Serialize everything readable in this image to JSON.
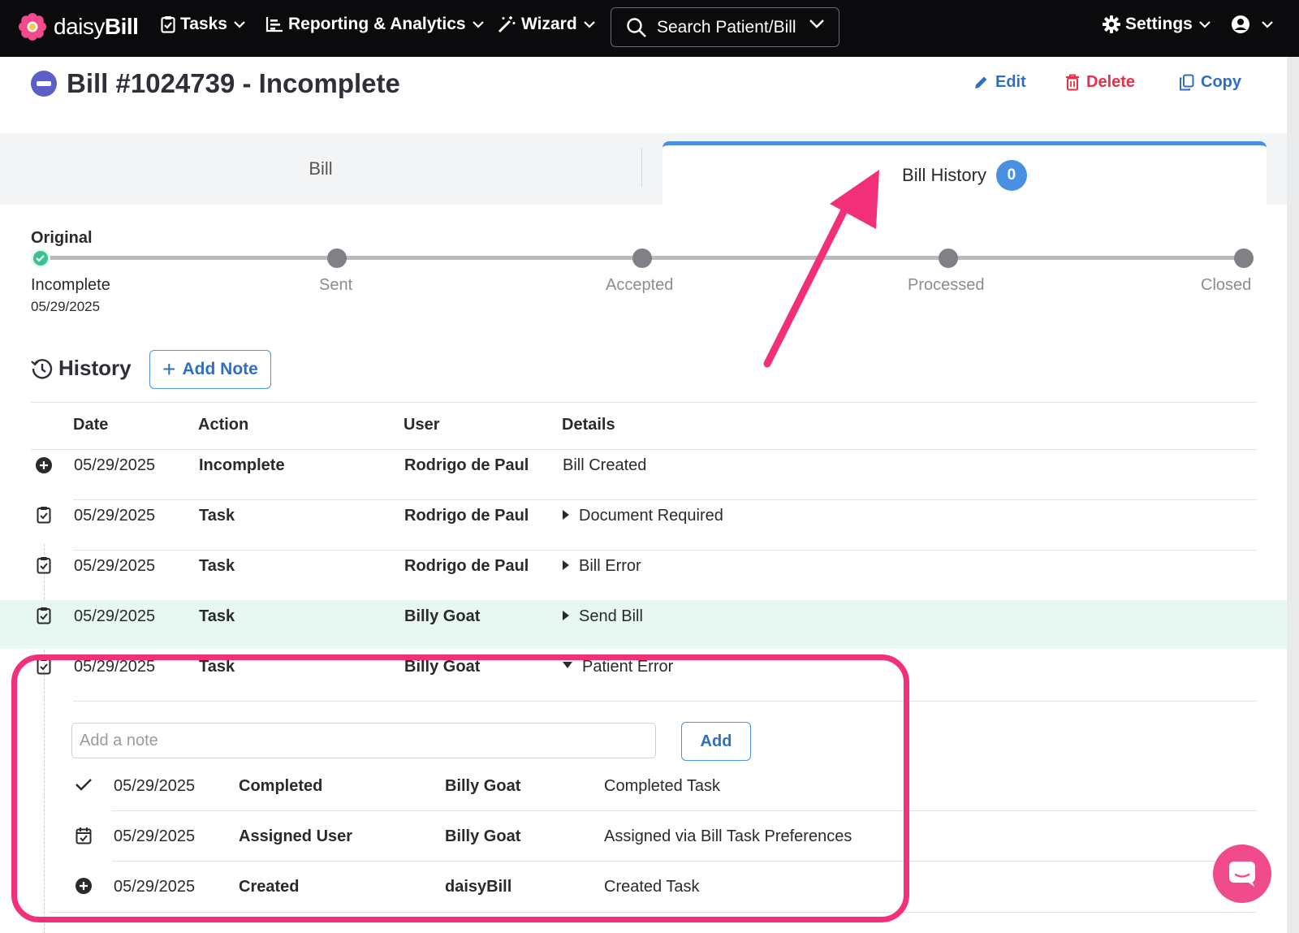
{
  "app": {
    "brand_light": "daisy",
    "brand_bold": "Bill"
  },
  "nav": {
    "tasks": "Tasks",
    "reporting": "Reporting & Analytics",
    "wizard": "Wizard",
    "search_label": "Search Patient/Bill",
    "settings": "Settings"
  },
  "header": {
    "title": "Bill #1024739 - Incomplete",
    "edit": "Edit",
    "delete": "Delete",
    "copy": "Copy"
  },
  "tabs": {
    "bill": "Bill",
    "history": "Bill History",
    "history_count": "0"
  },
  "progress": {
    "original_label": "Original",
    "date": "05/29/2025",
    "steps": [
      "Incomplete",
      "Sent",
      "Accepted",
      "Processed",
      "Closed"
    ]
  },
  "history": {
    "title": "History",
    "add_note": "Add Note",
    "columns": [
      "Date",
      "Action",
      "User",
      "Details"
    ],
    "rows": [
      {
        "date": "05/29/2025",
        "action": "Incomplete",
        "user": "Rodrigo de Paul",
        "details": "Bill Created",
        "icon": "plus-circle-icon"
      },
      {
        "date": "05/29/2025",
        "action": "Task",
        "user": "Rodrigo de Paul",
        "details": "Document Required",
        "icon": "clipboard-check-icon"
      },
      {
        "date": "05/29/2025",
        "action": "Task",
        "user": "Rodrigo de Paul",
        "details": "Bill Error",
        "icon": "clipboard-check-icon"
      },
      {
        "date": "05/29/2025",
        "action": "Task",
        "user": "Billy Goat",
        "details": "Send Bill",
        "icon": "clipboard-check-icon"
      },
      {
        "date": "05/29/2025",
        "action": "Task",
        "user": "Billy Goat",
        "details": "Patient Error",
        "icon": "clipboard-check-icon"
      }
    ],
    "note_placeholder": "Add a note",
    "add_button": "Add",
    "sub_rows": [
      {
        "date": "05/29/2025",
        "action": "Completed",
        "user": "Billy Goat",
        "details": "Completed Task",
        "icon": "check-icon"
      },
      {
        "date": "05/29/2025",
        "action": "Assigned User",
        "user": "Billy Goat",
        "details": "Assigned via Bill Task Preferences",
        "icon": "calendar-check-icon"
      },
      {
        "date": "05/29/2025",
        "action": "Created",
        "user": "daisyBill",
        "details": "Created Task",
        "icon": "plus-circle-icon"
      }
    ]
  },
  "colors": {
    "accent_blue": "#4a90e2",
    "delete_red": "#e5324a",
    "annotation_pink": "#f22f79",
    "highlight_row": "#e6f8f1"
  }
}
